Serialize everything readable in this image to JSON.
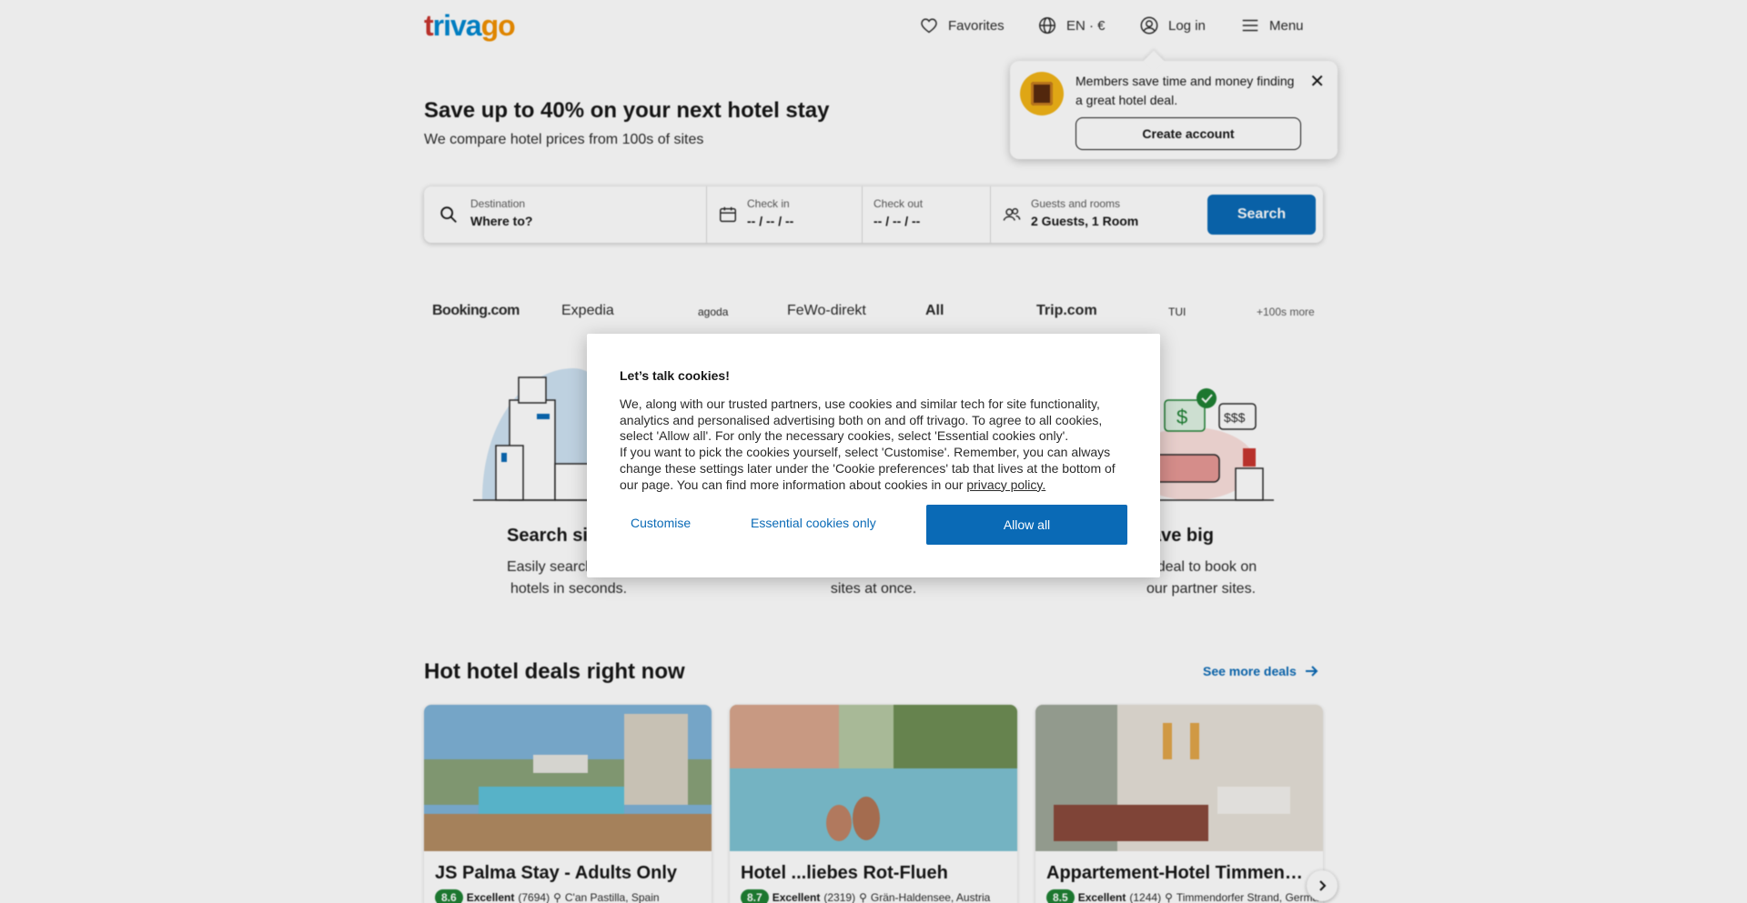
{
  "header": {
    "logo_parts": [
      "t",
      "riva",
      "go"
    ],
    "favorites_label": "Favorites",
    "language_label": "EN · €",
    "login_label": "Log in",
    "menu_label": "Menu"
  },
  "popover": {
    "text": "Members save time and money finding a great hotel deal.",
    "close_icon": "close-icon",
    "button_label": "Create account"
  },
  "hero": {
    "title": "Save up to 40% on your next hotel stay",
    "subtitle": "We compare hotel prices from 100s of sites"
  },
  "search": {
    "destination_label": "Destination",
    "destination_value": "Where to?",
    "checkin_label": "Check in",
    "checkin_value": "-- / -- / --",
    "checkout_label": "Check out",
    "checkout_value": "-- / -- / --",
    "guests_label": "Guests and rooms",
    "guests_value": "2 Guests, 1 Room",
    "button_label": "Search"
  },
  "partners": [
    "Booking.com",
    "Expedia",
    "agoda",
    "FeWo-direkt",
    "All",
    "Trip.com",
    "TUI",
    "+100s more"
  ],
  "features": [
    {
      "title": "Search si",
      "text_line1": "Easily search throu",
      "text_line2": "hotels in seconds."
    },
    {
      "title": "",
      "text_line1": "",
      "text_line2": "sites at once."
    },
    {
      "title": "ave big",
      "text_line1": "eat deal to book on",
      "text_line2": "our partner sites."
    }
  ],
  "cookie_modal": {
    "title": "Let’s talk cookies!",
    "body_part1": "We, along with our trusted partners, use cookies and similar tech for site functionality, analytics and personalised advertising both on and off trivago. To agree to all cookies, select 'Allow all'. For only the necessary cookies, select 'Essential cookies only'.",
    "body_part2": "If you want to pick the cookies yourself, select 'Customise'. Remember, you can always change these settings later under the 'Cookie preferences' tab that lives at the bottom of our page. You can find more information about cookies in our ",
    "privacy_link": "privacy policy.",
    "customise_label": "Customise",
    "essential_label": "Essential cookies only",
    "allow_all_label": "Allow all"
  },
  "deals": {
    "title": "Hot hotel deals right now",
    "see_more_label": "See more deals",
    "cards": [
      {
        "name": "JS Palma Stay - Adults Only",
        "rating": "8.6",
        "rating_word": "Excellent",
        "reviews": "(7694)",
        "location": "C'an Pastilla, Spain"
      },
      {
        "name": "Hotel ...liebes Rot-Flueh",
        "rating": "8.7",
        "rating_word": "Excellent",
        "reviews": "(2319)",
        "location": "Grän-Haldensee, Austria"
      },
      {
        "name": "Appartement-Hotel Timmendorfer",
        "rating": "8.5",
        "rating_word": "Excellent",
        "reviews": "(1244)",
        "location": "Timmendorfer Strand, Germany"
      }
    ]
  },
  "colors": {
    "brand_blue": "#0a6ab6",
    "rating_green": "#1f8234",
    "logo_red": "#c8362f",
    "logo_blue": "#0088d1",
    "logo_orange": "#f29100"
  }
}
